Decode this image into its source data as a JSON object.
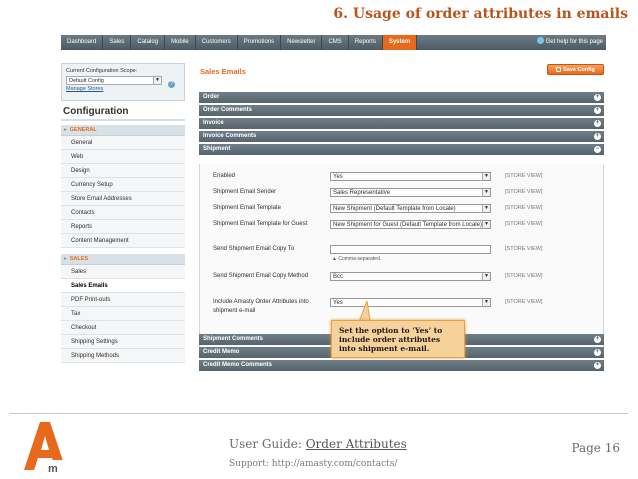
{
  "doc": {
    "title": "6. Usage of order attributes in emails",
    "footer": {
      "guide_prefix": "User Guide: ",
      "guide_link": "Order Attributes",
      "support": "Support: http://amasty.com/contacts/",
      "page": "Page 16"
    }
  },
  "nav": {
    "items": [
      "Dashboard",
      "Sales",
      "Catalog",
      "Mobile",
      "Customers",
      "Promotions",
      "Newsletter",
      "CMS",
      "Reports",
      "System"
    ],
    "active": "System",
    "help": "Get help for this page"
  },
  "sidebar": {
    "scope_label": "Current Configuration Scope:",
    "scope_value": "Default Config",
    "scope_link": "Manage Stores",
    "heading": "Configuration",
    "general_group": "GENERAL",
    "general_items": [
      "General",
      "Web",
      "Design",
      "Currency Setup",
      "Store Email Addresses",
      "Contacts",
      "Reports",
      "Content Management"
    ],
    "sales_group": "SALES",
    "sales_items": [
      "Sales",
      "Sales Emails",
      "PDF Print-outs",
      "Tax",
      "Checkout",
      "Shipping Settings",
      "Shipping Methods"
    ],
    "active_item": "Sales Emails"
  },
  "main": {
    "title": "Sales Emails",
    "save_label": "Save Config",
    "sections_top": [
      "Order",
      "Order Comments",
      "Invoice",
      "Invoice Comments",
      "Shipment"
    ],
    "sections_bottom": [
      "Shipment Comments",
      "Credit Memo",
      "Credit Memo Comments"
    ],
    "scope_tag": "[STORE VIEW]",
    "fields": [
      {
        "label": "Enabled",
        "value": "Yes",
        "type": "select"
      },
      {
        "label": "Shipment Email Sender",
        "value": "Sales Representative",
        "type": "select"
      },
      {
        "label": "Shipment Email Template",
        "value": "New Shipment (Default Template from Locale)",
        "type": "select"
      },
      {
        "label": "Shipment Email Template for Guest",
        "value": "New Shipment for Guest (Default Template from Locale)",
        "type": "select"
      },
      {
        "label": "Send Shipment Email Copy To",
        "value": "",
        "type": "text",
        "hint": "▲ Comma-separated."
      },
      {
        "label": "Send Shipment Email Copy Method",
        "value": "Bcc",
        "type": "select"
      },
      {
        "label": "Include Amasty Order Attributes into shipment e-mail",
        "value": "Yes",
        "type": "select"
      }
    ]
  },
  "callout": {
    "text": "Set the option to ‘Yes’ to include order attributes into shipment e-mail."
  },
  "colors": {
    "accent": "#e8691c",
    "nav_bg": "#5a6770",
    "section_bg": "#617079",
    "callout_bg": "#f6d29a"
  }
}
